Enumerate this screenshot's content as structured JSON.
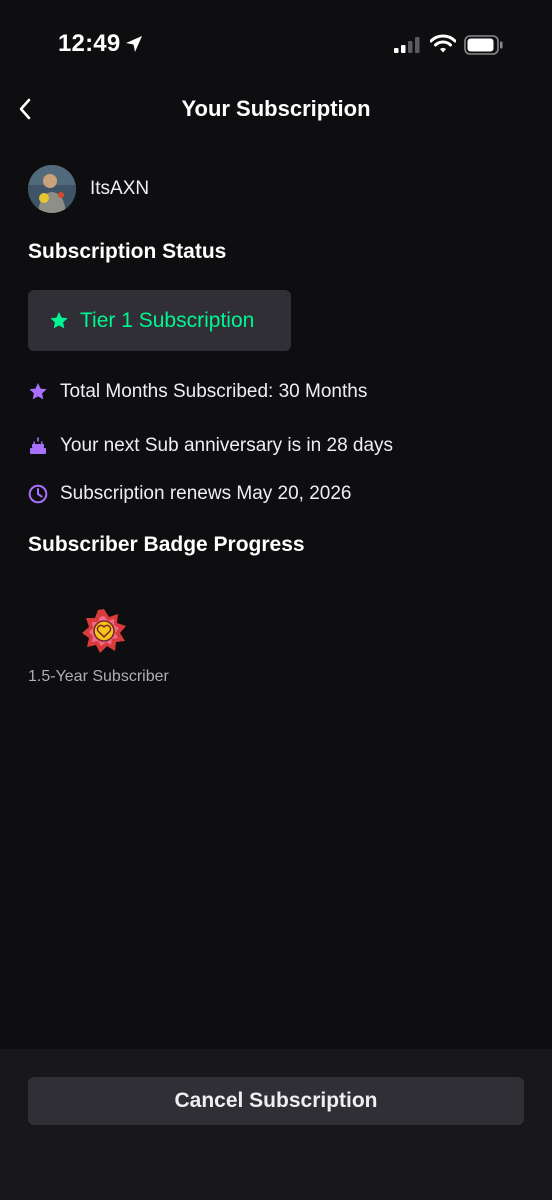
{
  "status_bar": {
    "time": "12:49"
  },
  "header": {
    "title": "Your Subscription"
  },
  "profile": {
    "username": "ItsAXN"
  },
  "subscription_status": {
    "title": "Subscription Status",
    "tier_label": "Tier 1 Subscription",
    "total_months": "Total Months Subscribed: 30 Months",
    "next_anniversary": "Your next Sub anniversary is in 28 days",
    "renewal": "Subscription renews May 20, 2026"
  },
  "badge_progress": {
    "title": "Subscriber Badge Progress",
    "badges": [
      {
        "label": "1.5-Year Subscriber",
        "icon": "subscriber-badge-icon"
      }
    ]
  },
  "footer": {
    "cancel_label": "Cancel Subscription"
  },
  "colors": {
    "background": "#0e0e10",
    "accent_green": "#00f593",
    "accent_purple": "#a970ff",
    "surface": "#2f2f35"
  }
}
